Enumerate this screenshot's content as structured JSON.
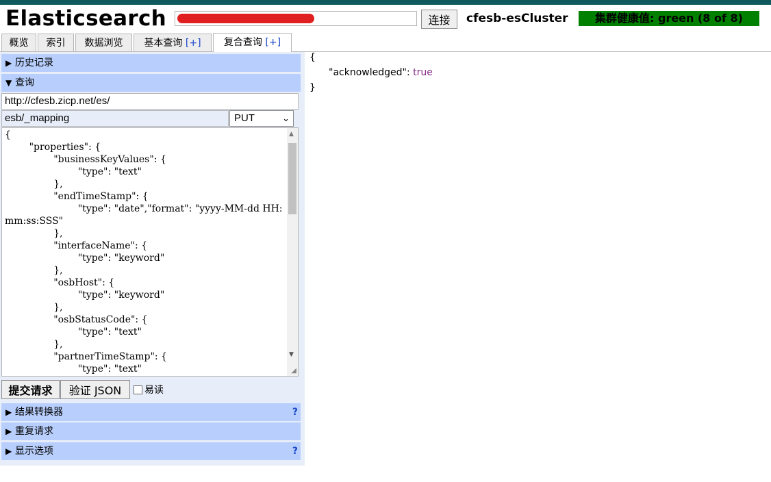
{
  "header": {
    "app_title": "Elasticsearch",
    "connect_label": "连接",
    "cluster_name": "cfesb-esCluster",
    "health_text": "集群健康值: green (8 of 8)",
    "health_color": "#008000"
  },
  "tabs": [
    {
      "label": "概览"
    },
    {
      "label": "索引"
    },
    {
      "label": "数据浏览"
    },
    {
      "label": "基本查询",
      "plus": "[+]"
    },
    {
      "label": "复合查询",
      "plus": "[+]",
      "active": true
    }
  ],
  "left": {
    "history_label": "历史记录",
    "query_label": "查询",
    "base_url": "http://cfesb.zicp.net/es/",
    "path": "esb/_mapping",
    "method": "PUT",
    "body": "{\n\t\"properties\": {\n\t\t\"businessKeyValues\": {\n\t\t\t\"type\": \"text\"\n\t\t},\n\t\t\"endTimeStamp\": {\n\t\t\t\"type\": \"date\",\"format\": \"yyyy-MM-dd HH:mm:ss:SSS\"\n\t\t},\n\t\t\"interfaceName\": {\n\t\t\t\"type\": \"keyword\"\n\t\t},\n\t\t\"osbHost\": {\n\t\t\t\"type\": \"keyword\"\n\t\t},\n\t\t\"osbStatusCode\": {\n\t\t\t\"type\": \"text\"\n\t\t},\n\t\t\"partnerTimeStamp\": {\n\t\t\t\"type\": \"text\"",
    "submit_label": "提交请求",
    "validate_label": "验证 JSON",
    "pretty_label": "易读",
    "transformer_label": "结果转换器",
    "repeat_label": "重复请求",
    "display_label": "显示选项",
    "help": "?"
  },
  "output": {
    "open": "{",
    "key": "\"acknowledged\"",
    "sep": ": ",
    "value": "true",
    "close": "}"
  }
}
